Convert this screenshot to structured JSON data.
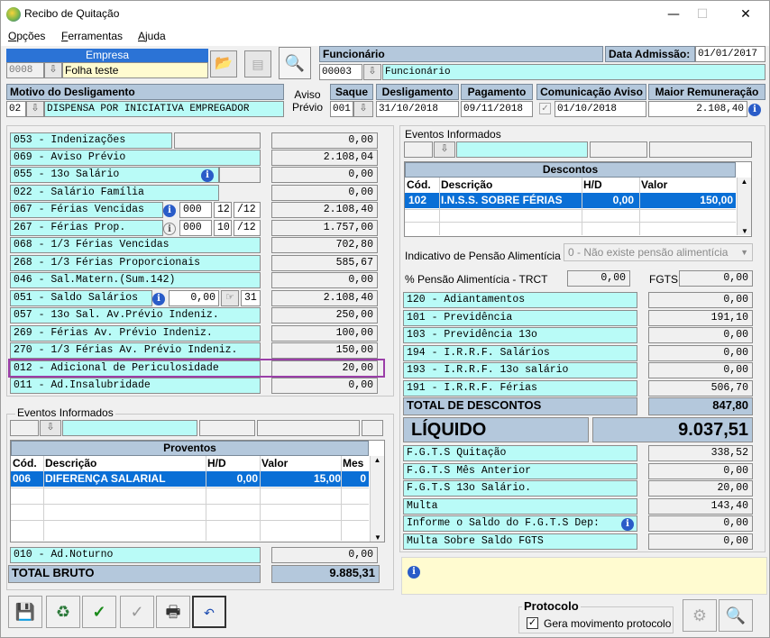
{
  "window": {
    "title": "Recibo de Quitação"
  },
  "menu": [
    "Opções",
    "Ferramentas",
    "Ajuda"
  ],
  "empresa": {
    "label": "Empresa",
    "code": "0008",
    "name": "Folha teste"
  },
  "funcionario": {
    "label": "Funcionário",
    "code": "00003",
    "name": "Funcionário"
  },
  "admissao": {
    "label": "Data Admissão:",
    "value": "01/01/2017"
  },
  "motivo": {
    "label": "Motivo do Desligamento",
    "code": "02",
    "value": "DISPENSA POR INICIATIVA EMPREGADOR",
    "aviso": "Aviso\nPrévio"
  },
  "saque": {
    "label": "Saque",
    "value": "001"
  },
  "desligamento": {
    "label": "Desligamento",
    "value": "31/10/2018"
  },
  "pagamento": {
    "label": "Pagamento",
    "value": "09/11/2018"
  },
  "comunicacao": {
    "label": "Comunicação Aviso",
    "value": "01/10/2018"
  },
  "maior": {
    "label": "Maior Remuneração",
    "value": "2.108,40"
  },
  "left_rows": [
    {
      "label": "053 - Indenizações",
      "value": "0,00"
    },
    {
      "label": "069 - Aviso Prévio",
      "value": "2.108,04"
    },
    {
      "label": "055 - 13o Salário",
      "value": "0,00"
    },
    {
      "label": "022 - Salário Família",
      "value": "0,00"
    },
    {
      "label": "067 - Férias Vencidas",
      "value": "2.108,40",
      "a": "000",
      "b": "12",
      "c": "/12"
    },
    {
      "label": "267 - Férias Prop.",
      "value": "1.757,00",
      "a": "000",
      "b": "10",
      "c": "/12"
    },
    {
      "label": "068 - 1/3 Férias Vencidas",
      "value": "702,80"
    },
    {
      "label": "268 - 1/3 Férias Proporcionais",
      "value": "585,67"
    },
    {
      "label": "046 - Sal.Matern.(Sum.142)",
      "value": "0,00"
    },
    {
      "label": "051 - Saldo Salários",
      "value": "2.108,40",
      "a": "0,00",
      "b": "31"
    },
    {
      "label": "057 - 13o Sal. Av.Prévio Indeniz.",
      "value": "250,00"
    },
    {
      "label": "269 - Férias  Av. Prévio Indeniz.",
      "value": "100,00"
    },
    {
      "label": "270 - 1/3 Férias Av. Prévio Indeniz.",
      "value": "150,00"
    },
    {
      "label": "012 - Adicional de Periculosidade",
      "value": "20,00"
    },
    {
      "label": "011 - Ad.Insalubridade",
      "value": "0,00"
    }
  ],
  "eventos_left": {
    "label": "Eventos Informados"
  },
  "proventos": {
    "title": "Proventos",
    "cols": [
      "Cód.",
      "Descrição",
      "H/D",
      "Valor",
      "Mes"
    ],
    "rows": [
      {
        "cod": "006",
        "desc": "DIFERENÇA SALARIAL",
        "hd": "0,00",
        "valor": "15,00",
        "mes": "0"
      }
    ]
  },
  "noturno": {
    "label": "010 - Ad.Noturno",
    "value": "0,00"
  },
  "total_bruto": {
    "label": "TOTAL BRUTO",
    "value": "9.885,31"
  },
  "eventos_right": {
    "label": "Eventos Informados"
  },
  "descontos": {
    "title": "Descontos",
    "cols": [
      "Cód.",
      "Descrição",
      "H/D",
      "Valor"
    ],
    "rows": [
      {
        "cod": "102",
        "desc": "I.N.S.S. SOBRE FÉRIAS",
        "hd": "0,00",
        "valor": "150,00"
      }
    ]
  },
  "pensao": {
    "label": "Indicativo de Pensão Alimentícia",
    "value": "0 - Não existe pensão alimentícia",
    "pct_label": "% Pensão Alimentícia - TRCT",
    "pct_value": "0,00",
    "fgts_label": "FGTS",
    "fgts_value": "0,00"
  },
  "right_rows": [
    {
      "label": "120 - Adiantamentos",
      "value": "0,00"
    },
    {
      "label": "101 - Previdência",
      "value": "191,10"
    },
    {
      "label": "103 - Previdência 13o",
      "value": "0,00"
    },
    {
      "label": "194 - I.R.R.F. Salários",
      "value": "0,00"
    },
    {
      "label": "193 - I.R.R.F. 13o salário",
      "value": "0,00"
    },
    {
      "label": "191 - I.R.R.F. Férias",
      "value": "506,70"
    }
  ],
  "total_descontos": {
    "label": "TOTAL DE DESCONTOS",
    "value": "847,80"
  },
  "liquido": {
    "label": "LÍQUIDO",
    "value": "9.037,51"
  },
  "fgts_rows": [
    {
      "label": "F.G.T.S  Quitação",
      "value": "338,52"
    },
    {
      "label": "F.G.T.S  Mês Anterior",
      "value": "0,00"
    },
    {
      "label": "F.G.T.S  13o Salário.",
      "value": "20,00"
    },
    {
      "label": "Multa",
      "value": "143,40"
    },
    {
      "label": "Informe o Saldo do F.G.T.S Dep:",
      "value": "0,00"
    },
    {
      "label": "Multa Sobre Saldo FGTS",
      "value": "0,00"
    }
  ],
  "protocolo": {
    "label": "Protocolo",
    "check": "Gera movimento protocolo"
  }
}
